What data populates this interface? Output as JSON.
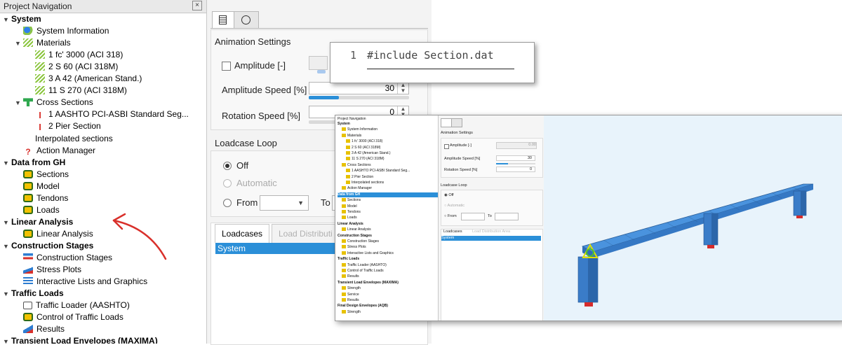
{
  "nav": {
    "title": "Project Navigation",
    "items": [
      {
        "label": "System",
        "level": 0,
        "bold": true,
        "expanded": true,
        "icon": "none"
      },
      {
        "label": "System Information",
        "level": 1,
        "icon": "system-info-icon"
      },
      {
        "label": "Materials",
        "level": 1,
        "expanded": true,
        "icon": "material-icon"
      },
      {
        "label": "1 fc' 3000 (ACI 318)",
        "level": 2,
        "icon": "material-icon"
      },
      {
        "label": "2 S 60 (ACI 318M)",
        "level": 2,
        "icon": "material-icon"
      },
      {
        "label": "3 A 42 (American Stand.)",
        "level": 2,
        "icon": "material-icon"
      },
      {
        "label": "11 S 270 (ACI 318M)",
        "level": 2,
        "icon": "material-icon"
      },
      {
        "label": "Cross Sections",
        "level": 1,
        "expanded": true,
        "icon": "cross-section-icon"
      },
      {
        "label": "1 AASHTO PCI-ASBI Standard Seg...",
        "level": 2,
        "icon": "section-icon"
      },
      {
        "label": "2 Pier Section",
        "level": 2,
        "icon": "section-icon"
      },
      {
        "label": "Interpolated sections",
        "level": 2,
        "icon": "none"
      },
      {
        "label": "Action Manager",
        "level": 1,
        "icon": "question-icon"
      },
      {
        "label": "Data from GH",
        "level": 0,
        "bold": true,
        "expanded": true,
        "icon": "none"
      },
      {
        "label": "Sections",
        "level": 1,
        "icon": "grasshopper-icon"
      },
      {
        "label": "Model",
        "level": 1,
        "icon": "grasshopper-icon"
      },
      {
        "label": "Tendons",
        "level": 1,
        "icon": "grasshopper-icon"
      },
      {
        "label": "Loads",
        "level": 1,
        "icon": "grasshopper-icon"
      },
      {
        "label": "Linear Analysis",
        "level": 0,
        "bold": true,
        "expanded": true,
        "icon": "none"
      },
      {
        "label": "Linear Analysis",
        "level": 1,
        "icon": "grasshopper-icon"
      },
      {
        "label": "Construction Stages",
        "level": 0,
        "bold": true,
        "expanded": true,
        "icon": "none"
      },
      {
        "label": "Construction Stages",
        "level": 1,
        "icon": "stages-icon"
      },
      {
        "label": "Stress Plots",
        "level": 1,
        "icon": "stress-plot-icon"
      },
      {
        "label": "Interactive Lists and Graphics",
        "level": 1,
        "icon": "list-icon"
      },
      {
        "label": "Traffic Loads",
        "level": 0,
        "bold": true,
        "expanded": true,
        "icon": "none"
      },
      {
        "label": "Traffic Loader (AASHTO)",
        "level": 1,
        "icon": "truck-icon"
      },
      {
        "label": "Control of Traffic Loads",
        "level": 1,
        "icon": "grasshopper-icon"
      },
      {
        "label": "Results",
        "level": 1,
        "icon": "results-icon"
      },
      {
        "label": "Transient Load Envelopes (MAXIMA)",
        "level": 0,
        "bold": true,
        "expanded": true,
        "icon": "none"
      }
    ]
  },
  "panel": {
    "animation_title": "Animation Settings",
    "amplitude_label": "Amplitude [-]",
    "amplitude_speed_label": "Amplitude Speed [%]",
    "amplitude_speed_value": "30",
    "amplitude_speed_fraction": 0.3,
    "rotation_speed_label": "Rotation Speed [%]",
    "rotation_speed_value": "0",
    "rotation_speed_fraction": 0.0,
    "loop_title": "Loadcase Loop",
    "radio_off": "Off",
    "radio_automatic": "Automatic",
    "radio_from": "From",
    "to_label": "To",
    "tab_loadcases": "Loadcases",
    "tab_load_distribution": "Load Distributi",
    "selected_row": "System"
  },
  "code": {
    "line_number": "1",
    "line_text": "#include Section.dat"
  },
  "mini": {
    "nav_title": "Project Navigation",
    "items": [
      {
        "label": "System",
        "level": 0,
        "bold": true
      },
      {
        "label": "System Information",
        "level": 1
      },
      {
        "label": "Materials",
        "level": 1
      },
      {
        "label": "1 fc' 3000 (ACI 318)",
        "level": 2
      },
      {
        "label": "2 S 60 (ACI 318M)",
        "level": 2
      },
      {
        "label": "3 A 42 (American Stand.)",
        "level": 2
      },
      {
        "label": "11 S 270 (ACI 318M)",
        "level": 2
      },
      {
        "label": "Cross Sections",
        "level": 1
      },
      {
        "label": "1 AASHTO PCI-ASBI Standard Seg...",
        "level": 2
      },
      {
        "label": "2 Pier Section",
        "level": 2
      },
      {
        "label": "Interpolated sections",
        "level": 2
      },
      {
        "label": "Action Manager",
        "level": 1
      },
      {
        "label": "Data from GH",
        "level": 0,
        "bold": true,
        "selected": true
      },
      {
        "label": "Sections",
        "level": 1
      },
      {
        "label": "Model",
        "level": 1
      },
      {
        "label": "Tendons",
        "level": 1
      },
      {
        "label": "Loads",
        "level": 1
      },
      {
        "label": "Linear Analysis",
        "level": 0,
        "bold": true
      },
      {
        "label": "Linear Analysis",
        "level": 1
      },
      {
        "label": "Construction Stages",
        "level": 0,
        "bold": true
      },
      {
        "label": "Construction Stages",
        "level": 1
      },
      {
        "label": "Stress Plots",
        "level": 1
      },
      {
        "label": "Interactive Lists and Graphics",
        "level": 1
      },
      {
        "label": "Traffic Loads",
        "level": 0,
        "bold": true
      },
      {
        "label": "Traffic Loader (AASHTO)",
        "level": 1
      },
      {
        "label": "Control of Traffic Loads",
        "level": 1
      },
      {
        "label": "Results",
        "level": 1
      },
      {
        "label": "Transient Load Envelopes (MAXIMA)",
        "level": 0,
        "bold": true
      },
      {
        "label": "Strength",
        "level": 1
      },
      {
        "label": "Service",
        "level": 1
      },
      {
        "label": "Results",
        "level": 1
      },
      {
        "label": "Final Design Envelopes (AQB)",
        "level": 0,
        "bold": true
      },
      {
        "label": "Strength",
        "level": 1
      }
    ],
    "animation_title": "Animation Settings",
    "amplitude_label": "Amplitude [-]",
    "amplitude_value": "0.00",
    "amplitude_speed_label": "Amplitude Speed [%]",
    "amplitude_speed_value": "30",
    "rotation_speed_label": "Rotation Speed [%]",
    "rotation_speed_value": "0",
    "loop_title": "Loadcase Loop",
    "radio_off": "Off",
    "radio_automatic": "Automatic",
    "radio_from": "From",
    "to_label": "To",
    "tab_loadcases": "Loadcases",
    "tab_load_distribution": "Load Distribution Area",
    "selected_row": "System"
  },
  "colors": {
    "accent": "#2b8fd8",
    "annotation": "#d9302b",
    "bridge": "#3f86d6"
  }
}
